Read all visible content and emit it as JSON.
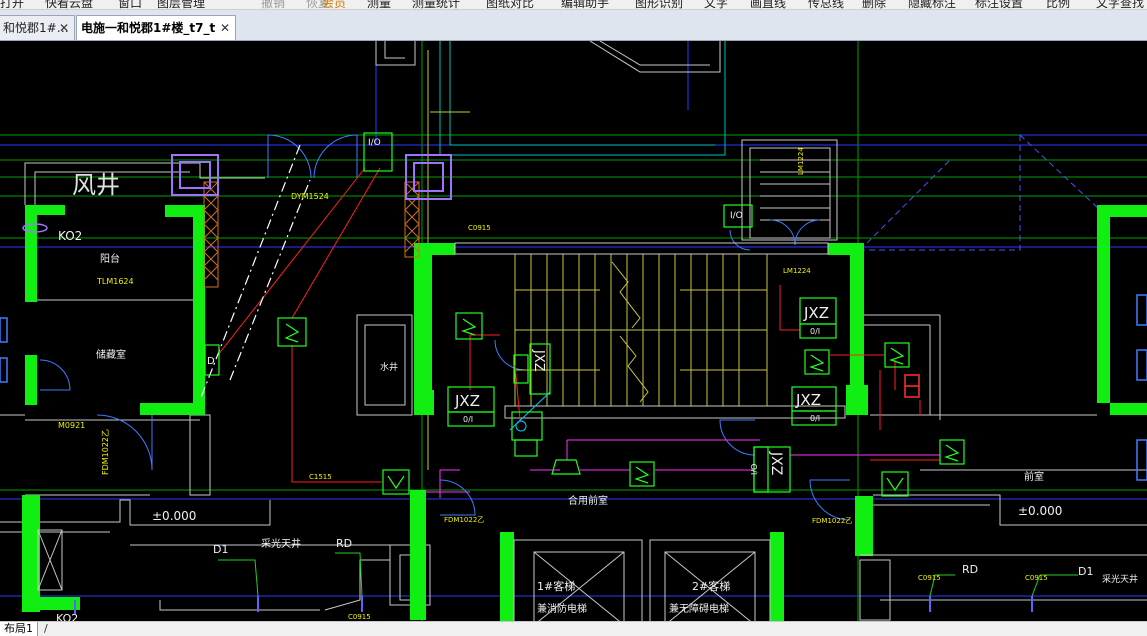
{
  "menu": [
    "打开",
    "快看云盘",
    "窗口",
    "图层管理",
    "撤销",
    "恢复",
    "会员",
    "测量",
    "测量统计",
    "图纸对比",
    "编辑助手",
    "图形识别",
    "文字",
    "画直线",
    "传总线",
    "删除",
    "隐藏标注",
    "标注设置",
    "比例",
    "文字查找"
  ],
  "tabs": [
    {
      "label": "和悦郡1#…",
      "close": "✕"
    },
    {
      "label": "电施一和悦郡1#楼_t7_t",
      "close": "✕"
    }
  ],
  "drawing": {
    "texts": {
      "fengjing": "风井",
      "ko2_top": "KO2",
      "yangtai": "阳台",
      "tlm": "TLM1624",
      "chucangshi": "储藏室",
      "m0921": "M0921",
      "fdm_left": "FDM1022乙",
      "elev_left": "±0.000",
      "d1_left": "D1",
      "rd_left": "RD",
      "caiguang_left": "采光天井",
      "ko2_bottom": "KO2",
      "c0915_bl": "C0915",
      "dym": "DYM1524",
      "io_top": "I/O",
      "shuijing": "水井",
      "d_box": "D",
      "c0915_stair": "C0915",
      "lm1224": "LM1224",
      "lm_side": "LM1224",
      "io_right": "I/O",
      "jxz_right_top": "JXZ",
      "o1_a": "0/I",
      "jxz_right_bot": "JXZ",
      "o1_b": "0/I",
      "jxz_left": "JXZ",
      "o1_c": "0/I",
      "jxz_vert": "JXZ",
      "jxz_center": "JXZ",
      "io_center": "I/O",
      "c1515": "C1515",
      "heyong": "合用前室",
      "fdm_mid": "FDM1022乙",
      "fdm_right": "FDM1022乙",
      "qianshi": "前室",
      "elev_right": "±0.000",
      "ke1": "1#客梯",
      "xf": "兼消防电梯",
      "ke2": "2#客梯",
      "wz": "兼无障碍电梯",
      "rd_right": "RD",
      "d1_right": "D1",
      "caiguang_right": "采光天井",
      "c0915_r1": "C0915",
      "c0915_r2": "C0915"
    }
  },
  "layout_tab": "布局1",
  "layout_sep": "/"
}
